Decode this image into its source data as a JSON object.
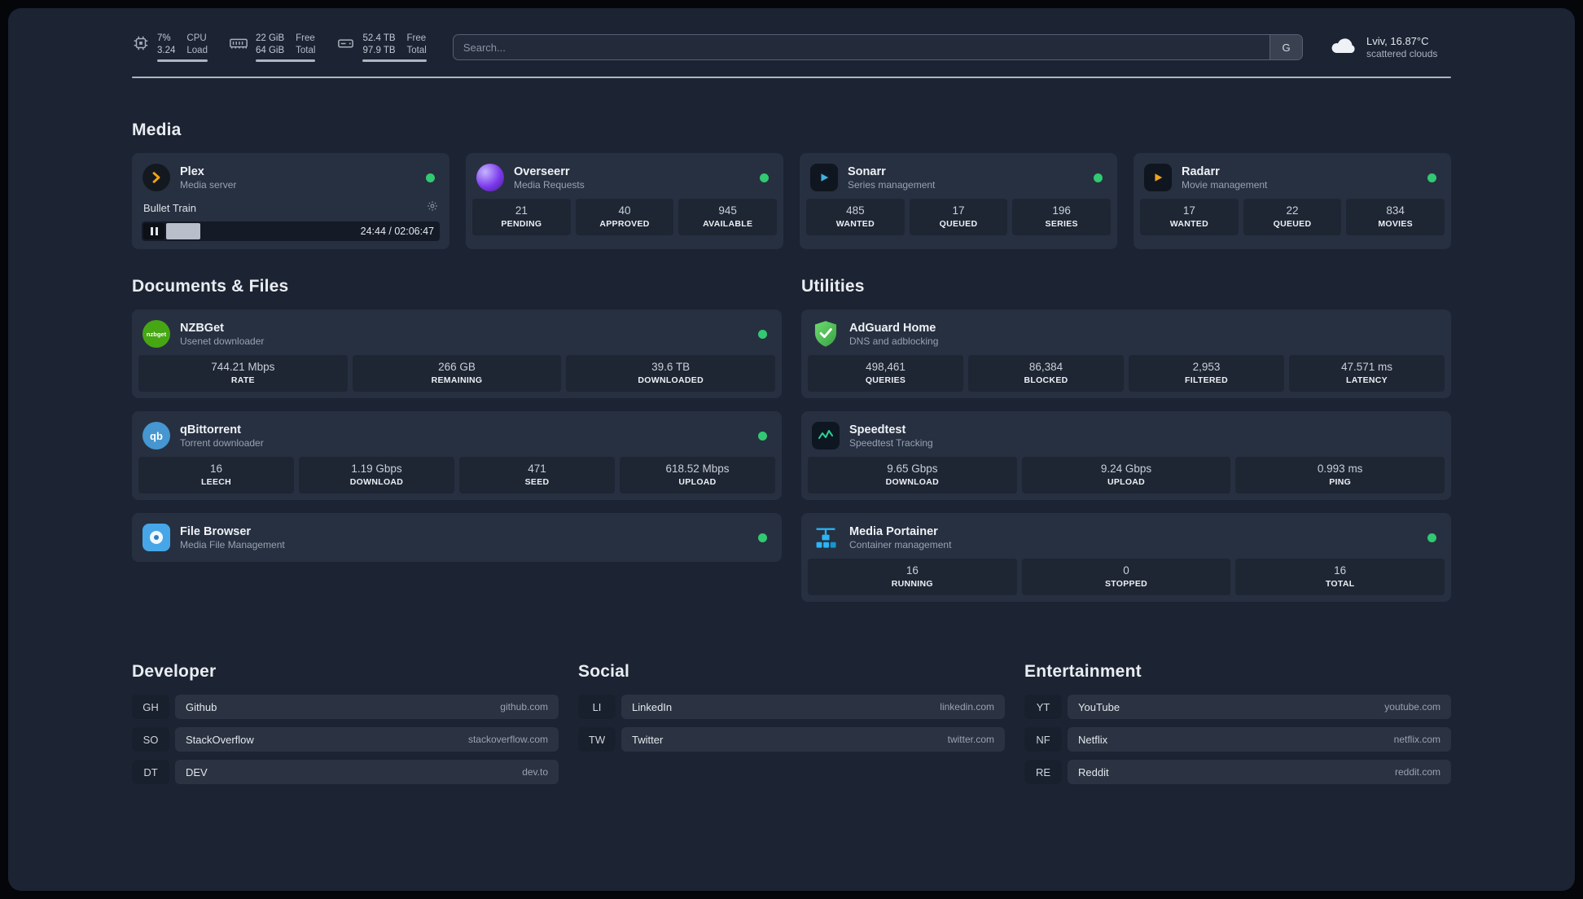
{
  "topbar": {
    "cpu": {
      "value1": "7%",
      "value2": "3.24",
      "label1": "CPU",
      "label2": "Load"
    },
    "memory": {
      "value1": "22 GiB",
      "value2": "64 GiB",
      "label1": "Free",
      "label2": "Total"
    },
    "disk": {
      "value1": "52.4 TB",
      "value2": "97.9 TB",
      "label1": "Free",
      "label2": "Total"
    },
    "search": {
      "placeholder": "Search...",
      "button": "G"
    },
    "weather": {
      "line1": "Lviv, 16.87°C",
      "line2": "scattered clouds"
    }
  },
  "media": {
    "title": "Media",
    "plex": {
      "name": "Plex",
      "desc": "Media server",
      "now_playing": "Bullet Train",
      "time": "24:44 / 02:06:47"
    },
    "overseerr": {
      "name": "Overseerr",
      "desc": "Media Requests",
      "stats": [
        {
          "value": "21",
          "label": "PENDING"
        },
        {
          "value": "40",
          "label": "APPROVED"
        },
        {
          "value": "945",
          "label": "AVAILABLE"
        }
      ]
    },
    "sonarr": {
      "name": "Sonarr",
      "desc": "Series management",
      "stats": [
        {
          "value": "485",
          "label": "WANTED"
        },
        {
          "value": "17",
          "label": "QUEUED"
        },
        {
          "value": "196",
          "label": "SERIES"
        }
      ]
    },
    "radarr": {
      "name": "Radarr",
      "desc": "Movie management",
      "stats": [
        {
          "value": "17",
          "label": "WANTED"
        },
        {
          "value": "22",
          "label": "QUEUED"
        },
        {
          "value": "834",
          "label": "MOVIES"
        }
      ]
    }
  },
  "documents": {
    "title": "Documents & Files",
    "nzbget": {
      "name": "NZBGet",
      "desc": "Usenet downloader",
      "icon_text": "nzbget",
      "stats": [
        {
          "value": "744.21 Mbps",
          "label": "RATE"
        },
        {
          "value": "266 GB",
          "label": "REMAINING"
        },
        {
          "value": "39.6 TB",
          "label": "DOWNLOADED"
        }
      ]
    },
    "qbittorrent": {
      "name": "qBittorrent",
      "desc": "Torrent downloader",
      "icon_text": "qb",
      "stats": [
        {
          "value": "16",
          "label": "LEECH"
        },
        {
          "value": "1.19 Gbps",
          "label": "DOWNLOAD"
        },
        {
          "value": "471",
          "label": "SEED"
        },
        {
          "value": "618.52 Mbps",
          "label": "UPLOAD"
        }
      ]
    },
    "filebrowser": {
      "name": "File Browser",
      "desc": "Media File Management"
    }
  },
  "utilities": {
    "title": "Utilities",
    "adguard": {
      "name": "AdGuard Home",
      "desc": "DNS and adblocking",
      "stats": [
        {
          "value": "498,461",
          "label": "QUERIES"
        },
        {
          "value": "86,384",
          "label": "BLOCKED"
        },
        {
          "value": "2,953",
          "label": "FILTERED"
        },
        {
          "value": "47.571 ms",
          "label": "LATENCY"
        }
      ]
    },
    "speedtest": {
      "name": "Speedtest",
      "desc": "Speedtest Tracking",
      "stats": [
        {
          "value": "9.65 Gbps",
          "label": "DOWNLOAD"
        },
        {
          "value": "9.24 Gbps",
          "label": "UPLOAD"
        },
        {
          "value": "0.993 ms",
          "label": "PING"
        }
      ]
    },
    "portainer": {
      "name": "Media Portainer",
      "desc": "Container management",
      "stats": [
        {
          "value": "16",
          "label": "RUNNING"
        },
        {
          "value": "0",
          "label": "STOPPED"
        },
        {
          "value": "16",
          "label": "TOTAL"
        }
      ]
    }
  },
  "bookmarks": [
    {
      "title": "Developer",
      "items": [
        {
          "abbr": "GH",
          "name": "Github",
          "url": "github.com"
        },
        {
          "abbr": "SO",
          "name": "StackOverflow",
          "url": "stackoverflow.com"
        },
        {
          "abbr": "DT",
          "name": "DEV",
          "url": "dev.to"
        }
      ]
    },
    {
      "title": "Social",
      "items": [
        {
          "abbr": "LI",
          "name": "LinkedIn",
          "url": "linkedin.com"
        },
        {
          "abbr": "TW",
          "name": "Twitter",
          "url": "twitter.com"
        }
      ]
    },
    {
      "title": "Entertainment",
      "items": [
        {
          "abbr": "YT",
          "name": "YouTube",
          "url": "youtube.com"
        },
        {
          "abbr": "NF",
          "name": "Netflix",
          "url": "netflix.com"
        },
        {
          "abbr": "RE",
          "name": "Reddit",
          "url": "reddit.com"
        }
      ]
    }
  ]
}
